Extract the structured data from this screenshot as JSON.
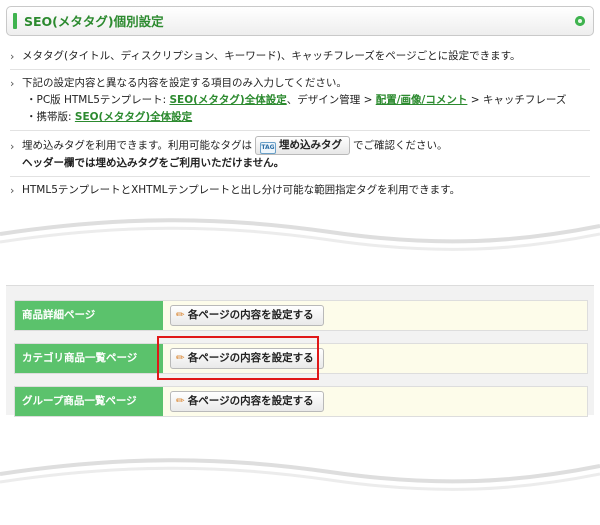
{
  "header": {
    "title": "SEO(メタタグ)個別設定"
  },
  "notes": {
    "line1": "メタタグ(タイトル、ディスクリプション、キーワード)、キャッチフレーズをページごとに設定できます。",
    "line2": "下記の設定内容と異なる内容を設定する項目のみ入力してください。",
    "pc_prefix": "・PC版 HTML5テンプレート: ",
    "pc_link1": "SEO(メタタグ)全体設定",
    "pc_mid": "、デザイン管理 > ",
    "pc_link2": "配置/画像/コメント",
    "pc_suffix": " > キャッチフレーズ",
    "mobile_prefix": "・携帯版: ",
    "mobile_link": "SEO(メタタグ)全体設定",
    "embed_prefix": "埋め込みタグを利用できます。利用可能なタグは",
    "embed_button": "埋め込みタグ",
    "embed_icon_text": "TAG",
    "embed_suffix": "でご確認ください。",
    "embed_warning": "ヘッダー欄では埋め込みタグをご利用いただけません。",
    "line4": "HTML5テンプレートとXHTMLテンプレートと出し分け可能な範囲指定タグを利用できます。"
  },
  "rows": [
    {
      "label": "商品詳細ページ",
      "button": "各ページの内容を設定する"
    },
    {
      "label": "カテゴリ商品一覧ページ",
      "button": "各ページの内容を設定する"
    },
    {
      "label": "グループ商品一覧ページ",
      "button": "各ページの内容を設定する"
    }
  ],
  "colors": {
    "accent_green": "#3fb34f",
    "label_green": "#5bc26c",
    "row_bg": "#fdfcea",
    "highlight_red": "#e01818"
  }
}
